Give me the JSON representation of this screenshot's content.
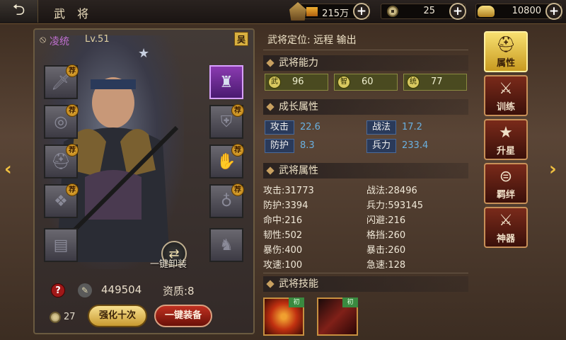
{
  "header": {
    "back_icon": "back-arrow-icon",
    "title": "武 将"
  },
  "resources": {
    "power": {
      "value": "215万",
      "fill": 0.2
    },
    "coins": {
      "value": "25"
    },
    "gold": {
      "value": "10800"
    },
    "plus_label": "+"
  },
  "hero": {
    "name": "凌统",
    "level": "Lv.51",
    "faction": "吴",
    "power": "449504",
    "aptitude": "资质:8",
    "unequip_label": "一键卸装"
  },
  "equipment": {
    "recommend_badge": "荐",
    "slots": [
      {
        "name": "weapon",
        "recommended": true
      },
      {
        "name": "helmet-or-emblem",
        "recommended": false,
        "equipped": true
      },
      {
        "name": "shield",
        "recommended": true
      },
      {
        "name": "armor",
        "recommended": true
      },
      {
        "name": "helmet",
        "recommended": true
      },
      {
        "name": "gloves",
        "recommended": true
      },
      {
        "name": "mount-accessory",
        "recommended": true
      },
      {
        "name": "gourd",
        "recommended": true
      },
      {
        "name": "book",
        "recommended": false
      },
      {
        "name": "horse",
        "recommended": false
      }
    ]
  },
  "bottom": {
    "help": "?",
    "coin_count": "27",
    "enhance_label": "强化十次",
    "equip_all_label": "一键装备"
  },
  "info": {
    "position_label": "武将定位: 远程 输出",
    "ability_header": "武将能力",
    "abilities": [
      {
        "icon": "武",
        "value": "96"
      },
      {
        "icon": "智",
        "value": "60"
      },
      {
        "icon": "统",
        "value": "77"
      }
    ],
    "growth_header": "成长属性",
    "growth": [
      {
        "label": "攻击",
        "value": "22.6"
      },
      {
        "label": "战法",
        "value": "17.2"
      },
      {
        "label": "防护",
        "value": "8.3"
      },
      {
        "label": "兵力",
        "value": "233.4"
      }
    ],
    "attr_header": "武将属性",
    "attrs_left": [
      "攻击:31773",
      "防护:3394",
      "命中:216",
      "韧性:502",
      "暴伤:400",
      "攻速:100"
    ],
    "attrs_right": [
      "战法:28496",
      "兵力:593145",
      "闪避:216",
      "格挡:260",
      "暴击:260",
      "急速:128"
    ],
    "skill_header": "武将技能",
    "skill_badge": "初"
  },
  "nav": [
    {
      "label": "属性",
      "icon": "helmet-icon",
      "glyph": "⛑",
      "active": true
    },
    {
      "label": "训练",
      "icon": "training-icon",
      "glyph": "⚔",
      "active": false
    },
    {
      "label": "升星",
      "icon": "star-up-icon",
      "glyph": "★",
      "active": false
    },
    {
      "label": "羁绊",
      "icon": "bond-icon",
      "glyph": "⊜",
      "active": false
    },
    {
      "label": "神器",
      "icon": "artifact-icon",
      "glyph": "⚔",
      "active": false
    }
  ],
  "arrows": {
    "left": "‹",
    "right": "›"
  },
  "colors": {
    "accent_gold": "#f0c040",
    "name_purple": "#c070d0",
    "growth_blue": "#6ab0e0"
  }
}
